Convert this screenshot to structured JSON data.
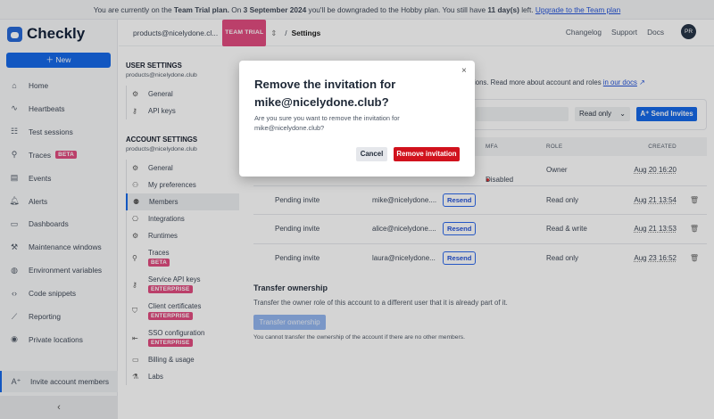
{
  "banner": {
    "pre": "You are currently on the ",
    "plan": "Team Trial plan.",
    "mid": " On ",
    "date": "3 September 2024",
    "mid2": " you'll be downgraded to the Hobby plan. You still have ",
    "days": "11 day(s)",
    "post": " left. ",
    "link": "Upgrade to the Team plan"
  },
  "app": {
    "name": "Checkly",
    "new_label": "New"
  },
  "sidebar": {
    "items": [
      {
        "label": "Home",
        "icon": "⌂"
      },
      {
        "label": "Heartbeats",
        "icon": "∿"
      },
      {
        "label": "Test sessions",
        "icon": "☷"
      },
      {
        "label": "Traces",
        "icon": "⚲",
        "badge": "BETA"
      },
      {
        "label": "Events",
        "icon": "▤"
      },
      {
        "label": "Alerts",
        "icon": "🔔︎"
      },
      {
        "label": "Dashboards",
        "icon": "▭"
      },
      {
        "label": "Maintenance windows",
        "icon": "⚒"
      },
      {
        "label": "Environment variables",
        "icon": "◍"
      },
      {
        "label": "Code snippets",
        "icon": "‹›"
      },
      {
        "label": "Reporting",
        "icon": "⟋"
      },
      {
        "label": "Private locations",
        "icon": "◉"
      }
    ],
    "invite": "Invite account members",
    "collapse": "‹"
  },
  "header": {
    "account": "products@nicelydone.cl...",
    "badge": "TEAM TRIAL",
    "sep": "/",
    "page": "Settings",
    "links": [
      "Changelog",
      "Support",
      "Docs"
    ],
    "avatar": "PR"
  },
  "settings_nav": {
    "user_title": "USER SETTINGS",
    "user_email": "products@nicelydone.club",
    "user_items": [
      "General",
      "API keys"
    ],
    "account_title": "ACCOUNT SETTINGS",
    "account_email": "products@nicelydone.club",
    "account_items": [
      {
        "label": "General"
      },
      {
        "label": "My preferences"
      },
      {
        "label": "Members"
      },
      {
        "label": "Integrations"
      },
      {
        "label": "Runtimes"
      },
      {
        "label": "Traces",
        "badge": "BETA"
      },
      {
        "label": "Service API keys",
        "badge": "ENTERPRISE"
      },
      {
        "label": "Client certificates",
        "badge": "ENTERPRISE"
      },
      {
        "label": "SSO configuration",
        "badge": "ENTERPRISE"
      },
      {
        "label": "Billing & usage"
      },
      {
        "label": "Labs"
      }
    ]
  },
  "members": {
    "intro": "ions. Read more about account and roles ",
    "docs_link": "in our docs",
    "role_select": "Read only",
    "send_label": "Send Invites",
    "columns": {
      "mfa": "MFA",
      "role": "ROLE",
      "created": "CREATED"
    },
    "owner_row": {
      "mfa": "Disabled",
      "role": "Owner",
      "created": "Aug 20 16:20"
    },
    "rows": [
      {
        "status": "Pending invite",
        "email": "mike@nicelydone....",
        "action": "Resend",
        "role": "Read only",
        "created": "Aug 21 13:54"
      },
      {
        "status": "Pending invite",
        "email": "alice@nicelydone....",
        "action": "Resend",
        "role": "Read & write",
        "created": "Aug 21 13:53"
      },
      {
        "status": "Pending invite",
        "email": "laura@nicelydone...",
        "action": "Resend",
        "role": "Read only",
        "created": "Aug 23 16:52"
      }
    ]
  },
  "transfer": {
    "title": "Transfer ownership",
    "desc": "Transfer the owner role of this account to a different user that it is already part of it.",
    "button": "Transfer ownership",
    "note": "You cannot transfer the ownership of the account if there are no other members."
  },
  "modal": {
    "title": "Remove the invitation for mike@nicelydone.club?",
    "body": "Are you sure you want to remove the invitation for mike@nicelydone.club?",
    "cancel": "Cancel",
    "confirm": "Remove invitation",
    "close": "×"
  },
  "colors": {
    "accent": "#0d63e8",
    "badge": "#e0457b",
    "danger": "#d1121d"
  }
}
